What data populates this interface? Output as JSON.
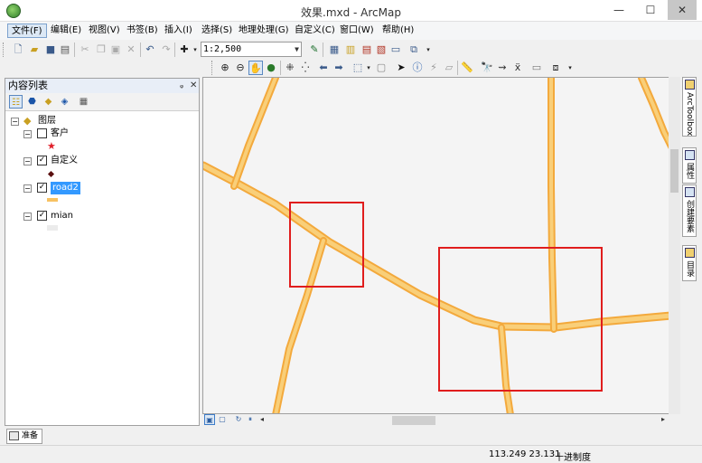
{
  "window": {
    "title": "效果.mxd - ArcMap",
    "minimize": "—",
    "maximize": "☐",
    "close": "✕"
  },
  "menu": {
    "items": [
      {
        "label": "文件(F)"
      },
      {
        "label": "编辑(E)"
      },
      {
        "label": "视图(V)"
      },
      {
        "label": "书签(B)"
      },
      {
        "label": "插入(I)"
      },
      {
        "label": "选择(S)"
      },
      {
        "label": "地理处理(G)"
      },
      {
        "label": "自定义(C)"
      },
      {
        "label": "窗口(W)"
      },
      {
        "label": "帮助(H)"
      }
    ]
  },
  "toolbar": {
    "scale_value": "1:2,500",
    "icons_row1": [
      "new-document-icon",
      "open-icon",
      "save-icon",
      "print-icon",
      "cut-icon",
      "copy-icon",
      "paste-icon",
      "delete-icon",
      "undo-icon",
      "redo-icon",
      "add-data-icon",
      "editor-icon",
      "table-of-contents-icon",
      "catalog-icon",
      "search-icon",
      "arctoolbox-icon",
      "python-icon",
      "model-builder-icon"
    ],
    "icons_row2": [
      "zoom-in-icon",
      "zoom-out-icon",
      "pan-icon",
      "full-extent-icon",
      "fixed-zoom-in-icon",
      "fixed-zoom-out-icon",
      "back-icon",
      "forward-icon",
      "select-features-icon",
      "clear-selection-icon",
      "select-elements-icon",
      "identify-icon",
      "hyperlink-icon",
      "html-popup-icon",
      "measure-icon",
      "find-icon",
      "find-route-icon",
      "go-to-xy-icon",
      "time-slider-icon",
      "create-viewer-icon"
    ]
  },
  "toc": {
    "title": "内容列表",
    "pin": "ᵩ",
    "close": "✕",
    "root_label": "图层",
    "layers": [
      {
        "name": "客户",
        "checked": false,
        "checkmark": "",
        "symbol": "★"
      },
      {
        "name": "自定义",
        "checked": true,
        "checkmark": "✓",
        "symbol": ""
      },
      {
        "name": "road2",
        "checked": true,
        "checkmark": "✓",
        "symbol": ""
      },
      {
        "name": "mian",
        "checked": true,
        "checkmark": "✓",
        "symbol": ""
      }
    ]
  },
  "left_tab": {
    "label": "准备"
  },
  "right_dock": {
    "tabs": [
      {
        "label": "ArcToolbox"
      },
      {
        "label": "属性"
      },
      {
        "label": "创建要素"
      },
      {
        "label": "目录"
      }
    ]
  },
  "colors": {
    "road_fill": "#f8c25e",
    "road_edge": "#f3a93c",
    "highlight_box": "#e01d1d"
  },
  "status": {
    "coords": "113.249  23.131",
    "units": "十进制度"
  }
}
